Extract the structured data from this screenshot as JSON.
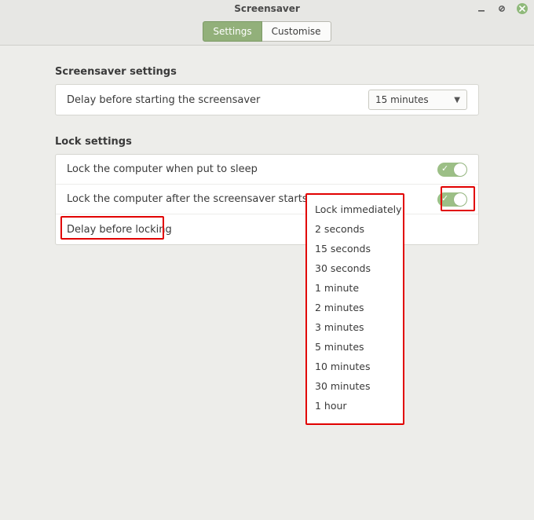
{
  "window": {
    "title": "Screensaver"
  },
  "tabs": {
    "settings": "Settings",
    "customise": "Customise"
  },
  "sectionA": {
    "title": "Screensaver settings",
    "row1_label": "Delay before starting the screensaver",
    "row1_value": "15 minutes"
  },
  "sectionB": {
    "title": "Lock settings",
    "row1_label": "Lock the computer when put to sleep",
    "row1_on": true,
    "row2_label": "Lock the computer after the screensaver starts",
    "row2_on": true,
    "row3_label": "Delay before locking",
    "row3_options": [
      "Lock immediately",
      "2 seconds",
      "15 seconds",
      "30 seconds",
      "1 minute",
      "2 minutes",
      "3 minutes",
      "5 minutes",
      "10 minutes",
      "30 minutes",
      "1 hour"
    ]
  }
}
